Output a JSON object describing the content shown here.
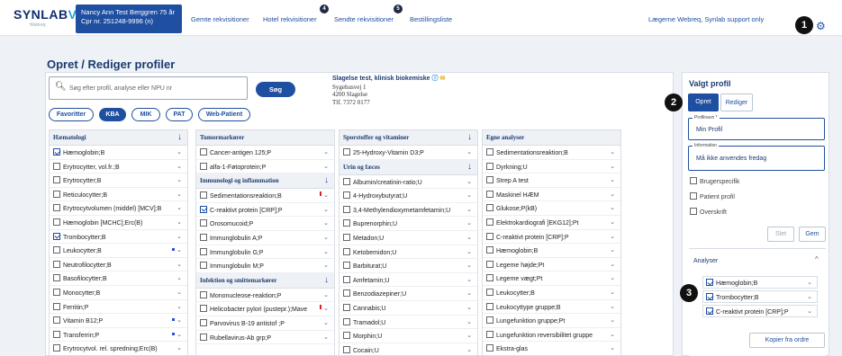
{
  "topbar": {
    "logo_text": "SYNLAB",
    "logo_sub": "Webreq",
    "patient_name": "Nancy Ann Test Berggren 75 år",
    "patient_cpr": "Cpr nr. 251248-9996 (n)",
    "nav": [
      {
        "label": "Gemte rekvisitioner",
        "badge": ""
      },
      {
        "label": "Hotel rekvisitioner",
        "badge": "4"
      },
      {
        "label": "Sendte rekvisitioner",
        "badge": "5"
      },
      {
        "label": "Bestillingsliste",
        "badge": ""
      }
    ],
    "right_link": "Lægerne Webreq, Synlab support only",
    "callout": "1"
  },
  "page_title": "Opret / Rediger profiler",
  "search": {
    "placeholder": "Søg efter profil, analyse eller NPU nr",
    "button": "Søg"
  },
  "lab": {
    "name": "Slagelse test, klinisk biokemiske",
    "address1": "Sygehusvej 1",
    "address2": "4200 Slagelse",
    "phone": "Tlf. 7372 0177"
  },
  "filters": [
    {
      "label": "Favoritter",
      "active": false
    },
    {
      "label": "KBA",
      "active": true
    },
    {
      "label": "MIK",
      "active": false
    },
    {
      "label": "PAT",
      "active": false
    },
    {
      "label": "Web-Patient",
      "active": false
    }
  ],
  "columns": [
    {
      "blocks": [
        {
          "section": "Hæmatologi",
          "items": [
            {
              "label": "Hæmoglobin;B",
              "checked": true
            },
            {
              "label": "Erytrocytter, vol.fr.;B",
              "checked": false
            },
            {
              "label": "Erytrocytter;B",
              "checked": false
            },
            {
              "label": "Reticulocytter;B",
              "checked": false
            },
            {
              "label": "Erytrocytvolumen (middel) [MCV];B",
              "checked": false
            },
            {
              "label": "Hæmoglobin [MCHC];Erc(B)",
              "checked": false
            },
            {
              "label": "Trombocytter;B",
              "checked": true
            },
            {
              "label": "Leukocytter;B",
              "checked": false,
              "mark": "blue"
            },
            {
              "label": "Neutrofilocytter;B",
              "checked": false
            },
            {
              "label": "Basofilocytter;B",
              "checked": false
            },
            {
              "label": "Monocytter;B",
              "checked": false
            },
            {
              "label": "Ferritin;P",
              "checked": false
            },
            {
              "label": "Vitamin B12;P",
              "checked": false,
              "mark": "blue"
            },
            {
              "label": "Transferrin;P",
              "checked": false,
              "mark": "blue"
            },
            {
              "label": "Erytrocytvol. rel. spredning;Erc(B)",
              "checked": false
            }
          ]
        }
      ]
    },
    {
      "blocks": [
        {
          "section": "Tumormarkører",
          "items": [
            {
              "label": "Cancer-antigen 125;P",
              "checked": false
            },
            {
              "label": "alfa-1-Føtoprotein;P",
              "checked": false
            }
          ]
        },
        {
          "section": "Immunologi og inflammation",
          "items": [
            {
              "label": "Sedimentationsreaktion;B",
              "checked": false,
              "mark": "red"
            },
            {
              "label": "C-reaktivt protein [CRP];P",
              "checked": true
            },
            {
              "label": "Orosomucoid;P",
              "checked": false
            },
            {
              "label": "Immunglobulin A;P",
              "checked": false
            },
            {
              "label": "Immunglobulin G;P",
              "checked": false
            },
            {
              "label": "Immunglobulin M;P",
              "checked": false
            }
          ]
        },
        {
          "section": "Infektion og smittemarkører",
          "items": [
            {
              "label": "Mononucleose-reaktion;P",
              "checked": false
            },
            {
              "label": "Helicobacter pylori (pustepr.);Mave",
              "checked": false,
              "mark": "red"
            },
            {
              "label": "Parvovirus B-19 antistof ;P",
              "checked": false
            },
            {
              "label": "Rubellavirus-Ab grp;P",
              "checked": false
            }
          ]
        }
      ]
    },
    {
      "blocks": [
        {
          "section": "Sporstoffer og vitaminer",
          "items": [
            {
              "label": "25-Hydroxy-Vitamin D3;P",
              "checked": false
            }
          ]
        },
        {
          "section": "Urin og fæces",
          "items": [
            {
              "label": "Albumin/creatinin-ratio;U",
              "checked": false
            },
            {
              "label": "4-Hydroxybutyrat;U",
              "checked": false
            },
            {
              "label": "3,4-Methylendioxymetamfetamin;U",
              "checked": false
            },
            {
              "label": "Buprenorphin;U",
              "checked": false
            },
            {
              "label": "Metadon;U",
              "checked": false
            },
            {
              "label": "Ketobemidon;U",
              "checked": false
            },
            {
              "label": "Barbiturat;U",
              "checked": false
            },
            {
              "label": "Amfetamin;U",
              "checked": false
            },
            {
              "label": "Benzodiazepiner;U",
              "checked": false
            },
            {
              "label": "Cannabis;U",
              "checked": false
            },
            {
              "label": "Tramadol;U",
              "checked": false
            },
            {
              "label": "Morphin;U",
              "checked": false
            },
            {
              "label": "Cocain;U",
              "checked": false
            }
          ]
        }
      ]
    },
    {
      "blocks": [
        {
          "section": "Egne analyser",
          "items": [
            {
              "label": "Sedimentationsreaktion;B",
              "checked": false
            },
            {
              "label": "Dyrkning;U",
              "checked": false
            },
            {
              "label": "Strep A test",
              "checked": false
            },
            {
              "label": "Maskinel HÆM",
              "checked": false
            },
            {
              "label": "Glukose;P(kB)",
              "checked": false
            },
            {
              "label": "Elektrokardiografi [EKG12];Pt",
              "checked": false
            },
            {
              "label": "C-reaktivt protein [CRP];P",
              "checked": false
            },
            {
              "label": "Hæmoglobin;B",
              "checked": false
            },
            {
              "label": "Legeme højde;Pt",
              "checked": false
            },
            {
              "label": "Legeme vægt;Pt",
              "checked": false
            },
            {
              "label": "Leukocytter;B",
              "checked": false
            },
            {
              "label": "Leukocyttype gruppe;B",
              "checked": false
            },
            {
              "label": "Lungefunktion gruppe;Pt",
              "checked": false
            },
            {
              "label": "Lungefunktion reversibilitet gruppe",
              "checked": false
            },
            {
              "label": "Ekstra-glas",
              "checked": false
            }
          ]
        }
      ]
    }
  ],
  "profile": {
    "title": "Valgt profil",
    "tabs": [
      "Opret",
      "Rediger"
    ],
    "callout2": "2",
    "name_label": "Profilnavn *",
    "name_value": "Min Profil",
    "info_label": "Information",
    "info_value": "Må ikke anvendes fredag",
    "options": [
      "Brugerspecifik",
      "Patient profil",
      "Overskrift"
    ],
    "delete_label": "Slet",
    "save_label": "Gem",
    "analyses_title": "Analyser",
    "callout3": "3",
    "analyses": [
      "Hæmoglobin;B",
      "Trombocytter;B",
      "C-reaktivt protein [CRP];P"
    ],
    "copy_label": "Kopier fra ordre"
  }
}
